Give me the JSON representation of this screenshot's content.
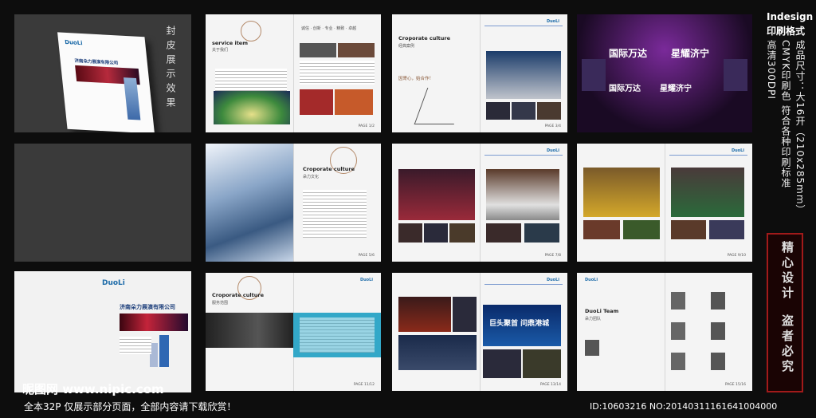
{
  "left_column": {
    "cover_caption": "封皮展示效果",
    "brand": "DuoLi",
    "company": "济南朵力展演有限公司"
  },
  "spreads": {
    "s1": {
      "heading": "service item",
      "sub": "关于我们",
      "services": "诚信 · 创新 · 专业 · 精致 · 卓越"
    },
    "s2": {
      "heading": "Croporate culture",
      "sub": "经典案例",
      "quote": "因寄心，始合作！"
    },
    "s3": {
      "sign_line1": "国际万达",
      "sign_line2": "星耀济宁"
    },
    "s4": {
      "heading": "Croporate culture",
      "sub": "朵力文化"
    },
    "s7": {
      "heading": "Croporate culture",
      "sub": "服务范围"
    },
    "s8": {
      "sign_text": "巨头聚首 问鼎港城"
    },
    "s9": {
      "heading": "DuoLi Team",
      "sub": "朵力团队"
    }
  },
  "right_column": {
    "title_en": "Indesign",
    "title_cn": "印刷格式",
    "spec1": "成品尺寸：大16开（210x285mm）",
    "spec2": "CMYK印刷色    符合各种印刷标准",
    "spec3": "高清300DPI",
    "seal1": "精心设计",
    "seal2": "盗者必究"
  },
  "footer": {
    "site": "昵图网 www.nipic.com",
    "note": "全本32P 仅展示部分页面，全部内容请下载欣赏！",
    "id": "ID:10603216 NO:20140311161641004000"
  }
}
